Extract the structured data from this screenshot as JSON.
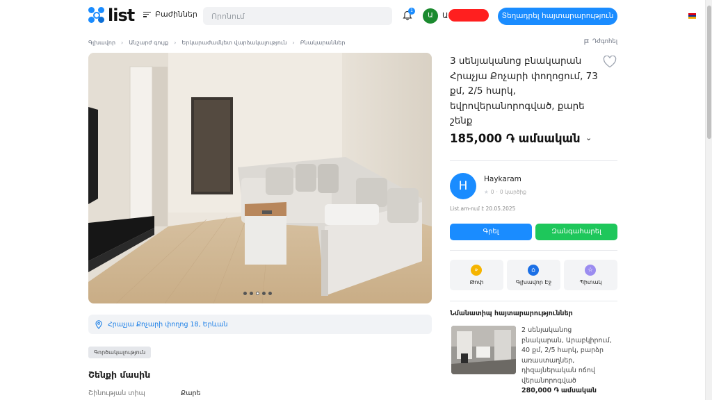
{
  "header": {
    "logo_text": "list",
    "categories_label": "Բաժիններ",
    "search_placeholder": "Որոնում",
    "notification_count": "1",
    "user_initial": "Ա",
    "user_name_visible": "Ա",
    "post_button": "Տեղադրել հայտարարություն"
  },
  "breadcrumb": {
    "items": [
      "Գլխավոր",
      "Անշարժ գույք",
      "Երկարաժամկետ վարձակալություն",
      "Բնակարաններ"
    ],
    "report": "Դժգոհել"
  },
  "gallery": {
    "dot_count": 5,
    "active_dot": 3
  },
  "address": "Հրաչյա Քոչարի փողոց 18, Երևան",
  "tag": "Գործակալություն",
  "building_section": {
    "title": "Շենքի մասին",
    "rows": [
      {
        "label": "Շինության տիպ",
        "value": "Քարե"
      }
    ]
  },
  "listing": {
    "title": "3 սենյականոց բնակարան Հրաչյա Քոչարի փողոցում, 73 քմ, 2/5 հարկ, եվրովերանորոգված, քարե շենք",
    "price": "185,000 ֏ ամսական"
  },
  "seller": {
    "initial": "H",
    "name": "Haykaram",
    "rating": "0",
    "reviews": "0 կարծիք",
    "posted": "List.am-ում է  20.05.2025"
  },
  "contact": {
    "write": "Գրել",
    "call": "Զանգահարել"
  },
  "actions": [
    {
      "label": "Թոփ",
      "icon": "up-arrows-icon",
      "color": "#f5b400"
    },
    {
      "label": "Գլխավոր Էջ",
      "icon": "home-icon",
      "color": "#1a6fe6"
    },
    {
      "label": "Պիտակ",
      "icon": "star-icon",
      "color": "#9b8cf0"
    }
  ],
  "similar": {
    "title": "Նմանատիպ հայտարարություններ",
    "items": [
      {
        "title": "2 սենյականոց բնակարան, Արաբկիրում, 40 քմ, 2/5 հարկ, բարձր առաստաղներ, դիզայներական ոճով վերանորոգված",
        "price": "280,000 ֏ ամսական"
      }
    ]
  }
}
